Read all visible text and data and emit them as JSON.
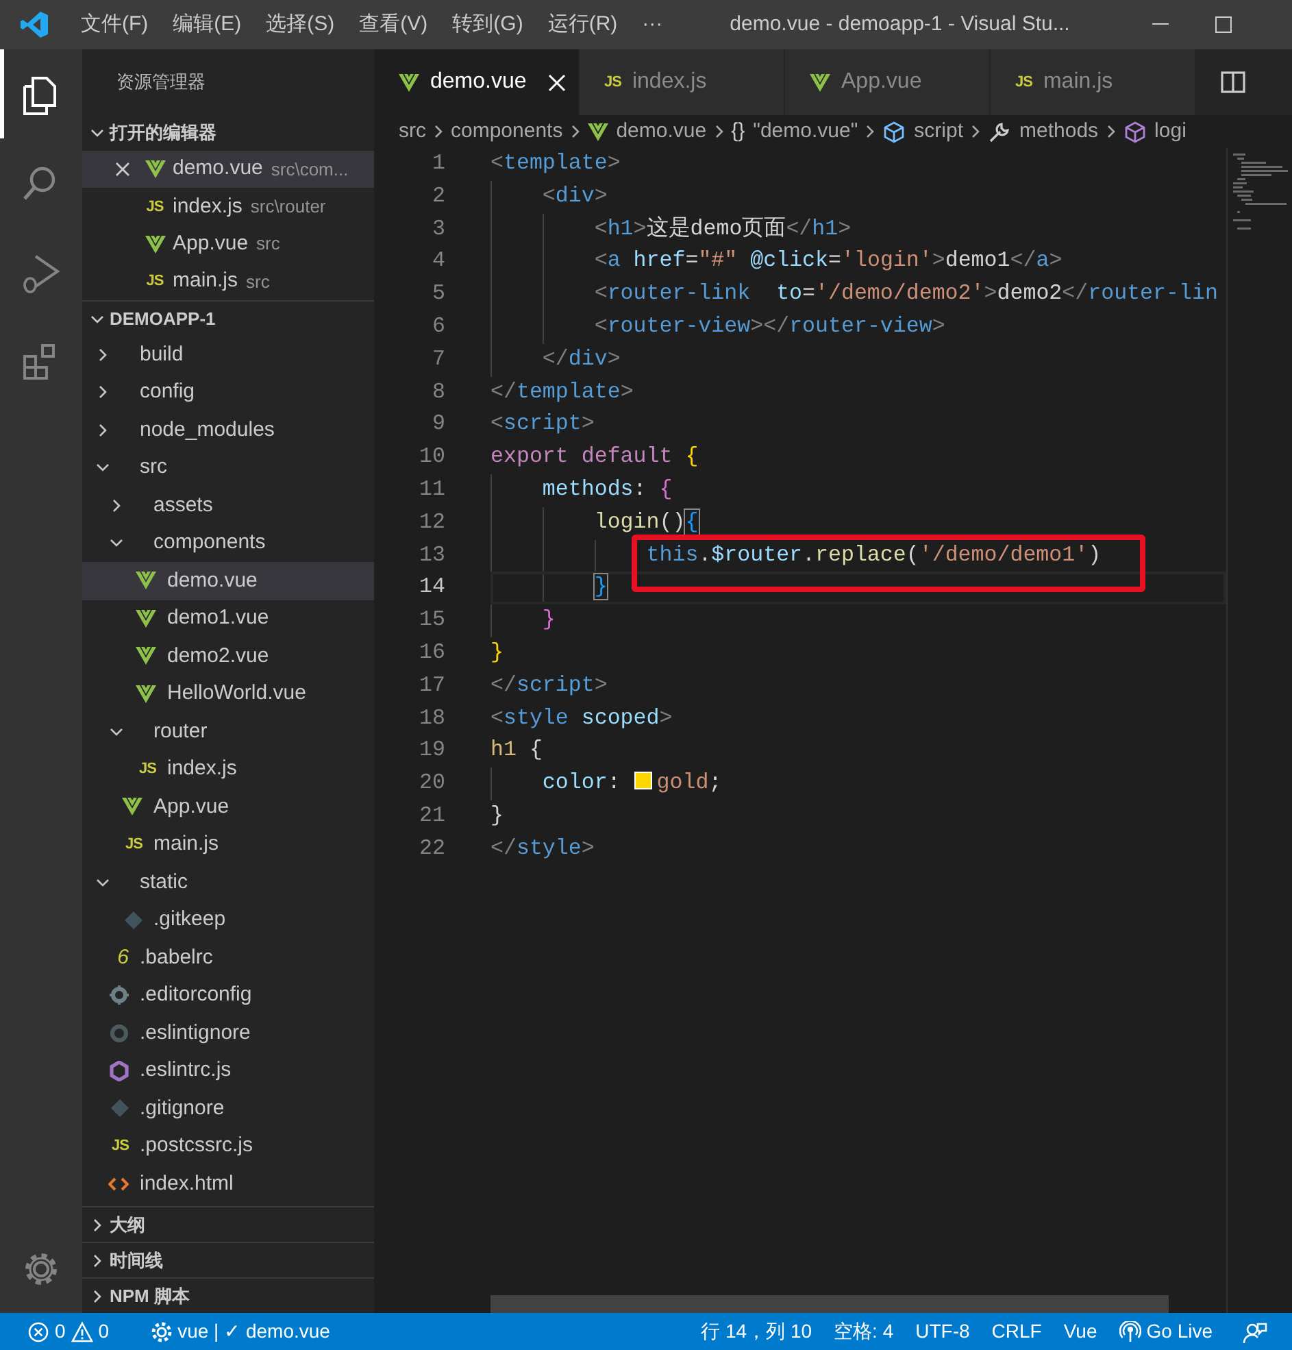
{
  "title_bar": {
    "menus": [
      "文件(F)",
      "编辑(E)",
      "选择(S)",
      "查看(V)",
      "转到(G)",
      "运行(R)"
    ],
    "more": "···",
    "title": "demo.vue - demoapp-1 - Visual Stu..."
  },
  "activity_bar": [
    {
      "kind": "explorer",
      "selected": true
    },
    {
      "kind": "search",
      "selected": false
    },
    {
      "kind": "run",
      "selected": false
    },
    {
      "kind": "extensions",
      "selected": false
    },
    {
      "kind": "settings",
      "selected": false
    }
  ],
  "sidebar": {
    "title": "资源管理器",
    "open_editors": {
      "header": "打开的编辑器",
      "expanded": true,
      "items": [
        {
          "label": "demo.vue",
          "description": "src\\com...",
          "kind": "vue",
          "selected": true
        },
        {
          "label": "index.js",
          "description": "src\\router",
          "kind": "js",
          "icon_text": "JS",
          "selected": false
        },
        {
          "label": "App.vue",
          "description": "src",
          "kind": "vue",
          "selected": false
        },
        {
          "label": "main.js",
          "description": "src",
          "kind": "js",
          "icon_text": "JS",
          "selected": false
        }
      ]
    },
    "project": {
      "header": "DEMOAPP-1",
      "expanded": true,
      "tree": [
        {
          "label": "build",
          "kind": "folder",
          "expanded": false,
          "selected": false
        },
        {
          "label": "config",
          "kind": "folder",
          "expanded": false,
          "selected": false
        },
        {
          "label": "node_modules",
          "kind": "folder",
          "expanded": false,
          "selected": false
        },
        {
          "label": "src",
          "kind": "folder",
          "expanded": true,
          "selected": false,
          "children": [
            {
              "label": "assets",
              "kind": "folder",
              "expanded": false,
              "selected": false
            },
            {
              "label": "components",
              "kind": "folder",
              "expanded": true,
              "selected": false,
              "children": [
                {
                  "label": "demo.vue",
                  "kind": "vue",
                  "selected": true
                },
                {
                  "label": "demo1.vue",
                  "kind": "vue",
                  "selected": false
                },
                {
                  "label": "demo2.vue",
                  "kind": "vue",
                  "selected": false
                },
                {
                  "label": "HelloWorld.vue",
                  "kind": "vue",
                  "selected": false
                }
              ]
            },
            {
              "label": "router",
              "kind": "folder",
              "expanded": true,
              "selected": false,
              "children": [
                {
                  "label": "index.js",
                  "kind": "js",
                  "icon_text": "JS",
                  "selected": false
                }
              ]
            },
            {
              "label": "App.vue",
              "kind": "vue",
              "selected": false
            },
            {
              "label": "main.js",
              "kind": "js",
              "icon_text": "JS",
              "selected": false
            }
          ]
        },
        {
          "label": "static",
          "kind": "folder",
          "expanded": true,
          "selected": false,
          "children": [
            {
              "label": ".gitkeep",
              "kind": "git",
              "selected": false
            }
          ]
        },
        {
          "label": ".babelrc",
          "kind": "babel",
          "icon_text": "6",
          "selected": false
        },
        {
          "label": ".editorconfig",
          "kind": "config",
          "selected": false
        },
        {
          "label": ".eslintignore",
          "kind": "ignore",
          "selected": false
        },
        {
          "label": ".eslintrc.js",
          "kind": "eslint",
          "selected": false
        },
        {
          "label": ".gitignore",
          "kind": "git",
          "selected": false
        },
        {
          "label": ".postcssrc.js",
          "kind": "js",
          "icon_text": "JS",
          "selected": false
        },
        {
          "label": "index.html",
          "kind": "html",
          "selected": false
        }
      ]
    },
    "sections": [
      {
        "header": "大纲",
        "expanded": false
      },
      {
        "header": "时间线",
        "expanded": false
      },
      {
        "header": "NPM 脚本",
        "expanded": false
      }
    ]
  },
  "tabs": [
    {
      "label": "demo.vue",
      "kind": "vue",
      "selected": true
    },
    {
      "label": "index.js",
      "kind": "js",
      "icon_text": "JS",
      "selected": false
    },
    {
      "label": "App.vue",
      "kind": "vue",
      "selected": false
    },
    {
      "label": "main.js",
      "kind": "js",
      "icon_text": "JS",
      "selected": false
    }
  ],
  "breadcrumb": [
    {
      "label": "src"
    },
    {
      "label": "components"
    },
    {
      "label": "demo.vue",
      "kind": "vue"
    },
    {
      "label": "\"demo.vue\"",
      "kind": "object",
      "icon_text": "{}"
    },
    {
      "label": "script",
      "kind": "module"
    },
    {
      "label": "methods",
      "kind": "property"
    },
    {
      "label": "logi",
      "kind": "method"
    }
  ],
  "editor": {
    "lines": [
      {
        "number": "1",
        "current": false,
        "highlighted": false,
        "tokens": [
          {
            "text": "<",
            "kind": "punct"
          },
          {
            "text": "template",
            "kind": "tag"
          },
          {
            "text": ">",
            "kind": "punct"
          }
        ]
      },
      {
        "number": "2",
        "current": false,
        "highlighted": false,
        "tokens": [
          {
            "text": "    <",
            "kind": "punct"
          },
          {
            "text": "div",
            "kind": "tag"
          },
          {
            "text": ">",
            "kind": "punct"
          }
        ]
      },
      {
        "number": "3",
        "current": false,
        "highlighted": false,
        "tokens": [
          {
            "text": "        <",
            "kind": "punct"
          },
          {
            "text": "h1",
            "kind": "tag"
          },
          {
            "text": ">",
            "kind": "punct"
          },
          {
            "text": "这是demo页面",
            "kind": "text"
          },
          {
            "text": "</",
            "kind": "punct"
          },
          {
            "text": "h1",
            "kind": "tag"
          },
          {
            "text": ">",
            "kind": "punct"
          }
        ]
      },
      {
        "number": "4",
        "current": false,
        "highlighted": false,
        "tokens": [
          {
            "text": "        <",
            "kind": "punct"
          },
          {
            "text": "a",
            "kind": "tag"
          },
          {
            "text": " href",
            "kind": "attr"
          },
          {
            "text": "=",
            "kind": "text"
          },
          {
            "text": "\"#\"",
            "kind": "string"
          },
          {
            "text": " @click",
            "kind": "attr"
          },
          {
            "text": "=",
            "kind": "text"
          },
          {
            "text": "'login'",
            "kind": "string"
          },
          {
            "text": ">",
            "kind": "punct"
          },
          {
            "text": "demo1",
            "kind": "text"
          },
          {
            "text": "</",
            "kind": "punct"
          },
          {
            "text": "a",
            "kind": "tag"
          },
          {
            "text": ">",
            "kind": "punct"
          }
        ]
      },
      {
        "number": "5",
        "current": false,
        "highlighted": false,
        "tokens": [
          {
            "text": "        <",
            "kind": "punct"
          },
          {
            "text": "router-link",
            "kind": "tag"
          },
          {
            "text": "  to",
            "kind": "attr"
          },
          {
            "text": "=",
            "kind": "text"
          },
          {
            "text": "'/demo/demo2'",
            "kind": "string"
          },
          {
            "text": ">",
            "kind": "punct"
          },
          {
            "text": "demo2",
            "kind": "text"
          },
          {
            "text": "</",
            "kind": "punct"
          },
          {
            "text": "router-lin",
            "kind": "tag"
          }
        ]
      },
      {
        "number": "6",
        "current": false,
        "highlighted": false,
        "tokens": [
          {
            "text": "        <",
            "kind": "punct"
          },
          {
            "text": "router-view",
            "kind": "tag"
          },
          {
            "text": "></",
            "kind": "punct"
          },
          {
            "text": "router-view",
            "kind": "tag"
          },
          {
            "text": ">",
            "kind": "punct"
          }
        ]
      },
      {
        "number": "7",
        "current": false,
        "highlighted": false,
        "tokens": [
          {
            "text": "    </",
            "kind": "punct"
          },
          {
            "text": "div",
            "kind": "tag"
          },
          {
            "text": ">",
            "kind": "punct"
          }
        ]
      },
      {
        "number": "8",
        "current": false,
        "highlighted": false,
        "tokens": [
          {
            "text": "</",
            "kind": "punct"
          },
          {
            "text": "template",
            "kind": "tag"
          },
          {
            "text": ">",
            "kind": "punct"
          }
        ]
      },
      {
        "number": "9",
        "current": false,
        "highlighted": false,
        "tokens": [
          {
            "text": "<",
            "kind": "punct"
          },
          {
            "text": "script",
            "kind": "tag"
          },
          {
            "text": ">",
            "kind": "punct"
          }
        ]
      },
      {
        "number": "10",
        "current": false,
        "highlighted": false,
        "tokens": [
          {
            "text": "export default ",
            "kind": "keyword"
          },
          {
            "text": "{",
            "kind": "brace1"
          }
        ]
      },
      {
        "number": "11",
        "current": false,
        "highlighted": false,
        "tokens": [
          {
            "text": "    methods",
            "kind": "attr"
          },
          {
            "text": ": ",
            "kind": "text"
          },
          {
            "text": "{",
            "kind": "brace2"
          }
        ]
      },
      {
        "number": "12",
        "current": false,
        "highlighted": false,
        "tokens": [
          {
            "text": "        login",
            "kind": "function"
          },
          {
            "text": "()",
            "kind": "text"
          },
          {
            "text": "{",
            "kind": "brace3",
            "matched": true
          }
        ]
      },
      {
        "number": "13",
        "current": false,
        "highlighted": true,
        "tokens": [
          {
            "text": "            this",
            "kind": "tag"
          },
          {
            "text": ".",
            "kind": "text"
          },
          {
            "text": "$router",
            "kind": "attr"
          },
          {
            "text": ".",
            "kind": "text"
          },
          {
            "text": "replace",
            "kind": "function"
          },
          {
            "text": "(",
            "kind": "text"
          },
          {
            "text": "'/demo/demo1'",
            "kind": "string"
          },
          {
            "text": ")",
            "kind": "text"
          }
        ]
      },
      {
        "number": "14",
        "current": true,
        "highlighted": false,
        "tokens": [
          {
            "text": "        }",
            "kind": "brace3",
            "matched": true
          }
        ]
      },
      {
        "number": "15",
        "current": false,
        "highlighted": false,
        "tokens": [
          {
            "text": "    }",
            "kind": "brace2"
          }
        ]
      },
      {
        "number": "16",
        "current": false,
        "highlighted": false,
        "tokens": [
          {
            "text": "}",
            "kind": "brace1"
          }
        ]
      },
      {
        "number": "17",
        "current": false,
        "highlighted": false,
        "tokens": [
          {
            "text": "</",
            "kind": "punct"
          },
          {
            "text": "script",
            "kind": "tag"
          },
          {
            "text": ">",
            "kind": "punct"
          }
        ]
      },
      {
        "number": "18",
        "current": false,
        "highlighted": false,
        "tokens": [
          {
            "text": "<",
            "kind": "punct"
          },
          {
            "text": "style",
            "kind": "tag"
          },
          {
            "text": " scoped",
            "kind": "attr"
          },
          {
            "text": ">",
            "kind": "punct"
          }
        ]
      },
      {
        "number": "19",
        "current": false,
        "highlighted": false,
        "tokens": [
          {
            "text": "h1",
            "kind": "selector"
          },
          {
            "text": " {",
            "kind": "text"
          }
        ]
      },
      {
        "number": "20",
        "current": false,
        "highlighted": false,
        "tokens": [
          {
            "text": "    color",
            "kind": "attr"
          },
          {
            "text": ": ",
            "kind": "text"
          },
          {
            "kind": "swatch",
            "color": "#ffd700"
          },
          {
            "text": "gold",
            "kind": "string"
          },
          {
            "text": ";",
            "kind": "text"
          }
        ]
      },
      {
        "number": "21",
        "current": false,
        "highlighted": false,
        "tokens": [
          {
            "text": "}",
            "kind": "text"
          }
        ]
      },
      {
        "number": "22",
        "current": false,
        "highlighted": false,
        "tokens": [
          {
            "text": "</",
            "kind": "punct"
          },
          {
            "text": "style",
            "kind": "tag"
          },
          {
            "text": ">",
            "kind": "punct"
          }
        ]
      }
    ]
  },
  "status_bar": {
    "left": [
      {
        "kind": "errors",
        "text": "0"
      },
      {
        "kind": "warnings",
        "text": "0"
      },
      {
        "kind": "vetur",
        "text": "vue | ✓ demo.vue"
      }
    ],
    "right": [
      {
        "text": "行 14，列 10"
      },
      {
        "text": "空格: 4"
      },
      {
        "text": "UTF-8"
      },
      {
        "text": "CRLF"
      },
      {
        "text": "Vue"
      },
      {
        "kind": "live",
        "text": "Go Live"
      },
      {
        "kind": "feedback"
      }
    ]
  }
}
